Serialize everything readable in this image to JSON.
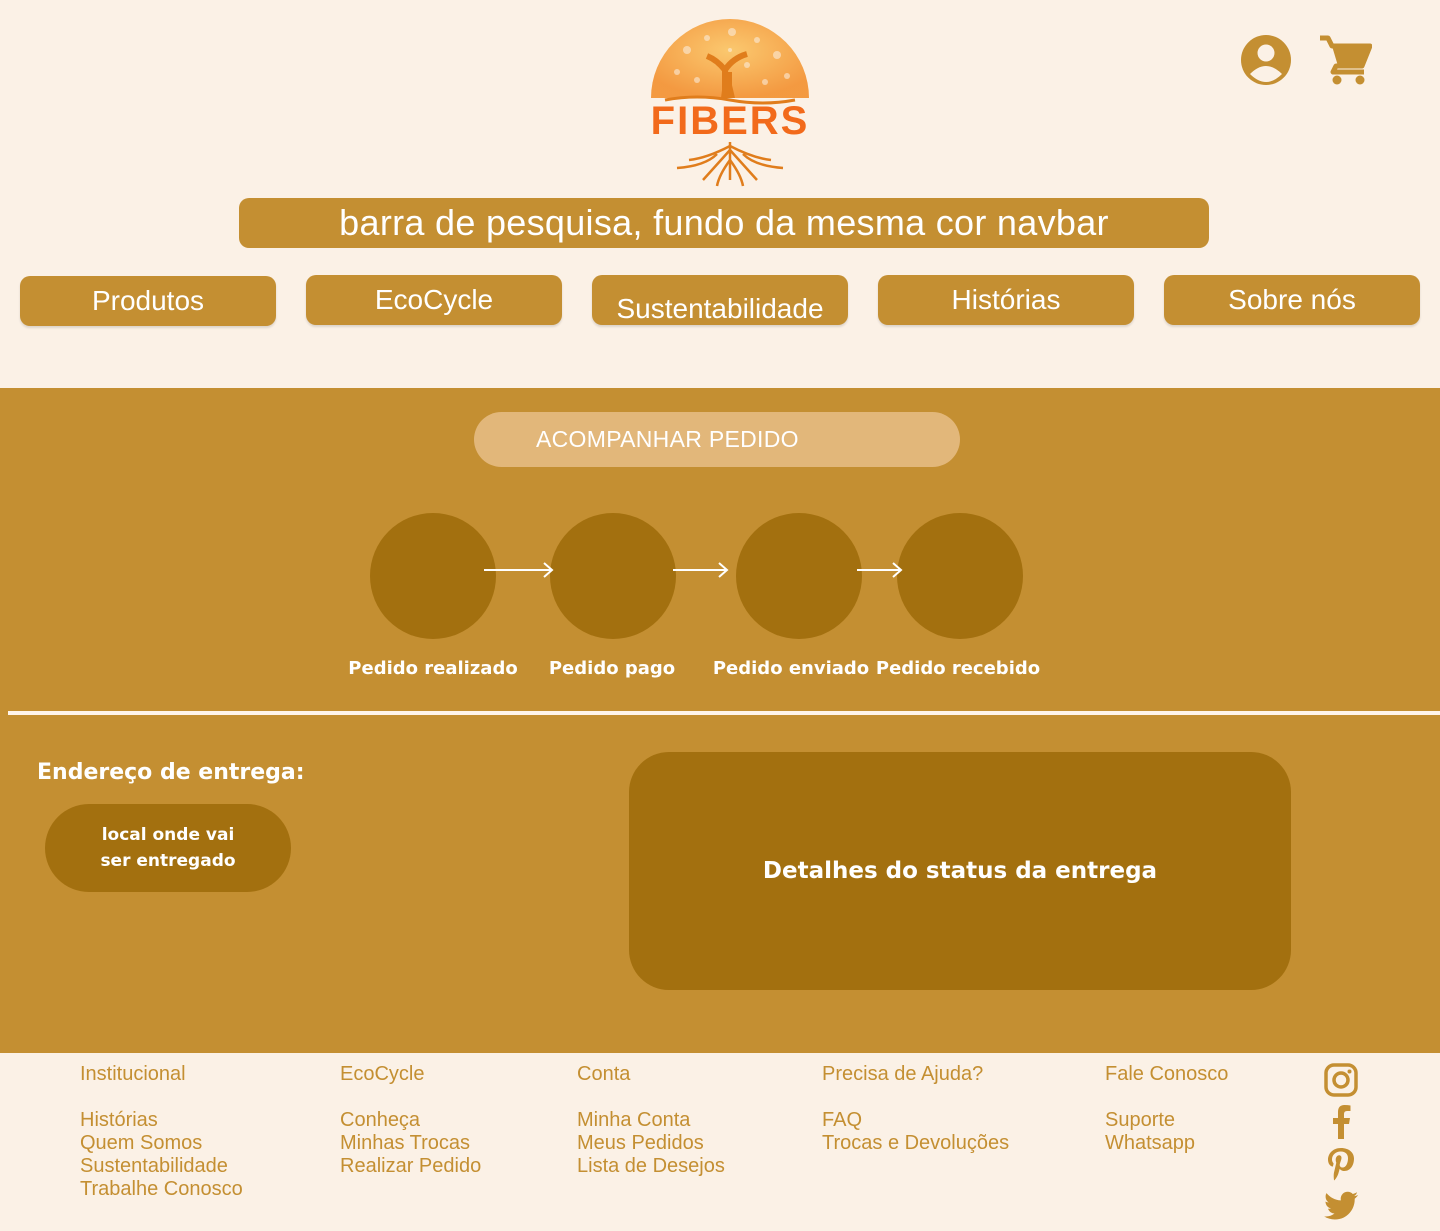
{
  "brand": {
    "name": "FIBERS"
  },
  "header": {
    "icons": [
      "user-account-icon",
      "shopping-cart-icon"
    ]
  },
  "search": {
    "placeholder_text": "barra de pesquisa, fundo da mesma cor navbar"
  },
  "nav": {
    "items": [
      "Produtos",
      "EcoCycle",
      "Sustentabilidade",
      "Histórias",
      "Sobre nós"
    ]
  },
  "tracking": {
    "title": "ACOMPANHAR PEDIDO",
    "steps": [
      "Pedido realizado",
      "Pedido pago",
      "Pedido enviado",
      "Pedido recebido"
    ]
  },
  "address": {
    "title": "Endereço de entrega:",
    "value": "local onde vai ser entregado"
  },
  "status": {
    "details_label": "Detalhes do status da entrega"
  },
  "footer": {
    "columns": [
      {
        "heading": "Institucional",
        "links": [
          "Histórias",
          "Quem Somos",
          "Sustentabilidade",
          "Trabalhe Conosco"
        ]
      },
      {
        "heading": "EcoCycle",
        "links": [
          "Conheça",
          "Minhas Trocas",
          "Realizar Pedido"
        ]
      },
      {
        "heading": "Conta",
        "links": [
          "Minha Conta",
          "Meus Pedidos",
          "Lista de Desejos"
        ]
      },
      {
        "heading": "Precisa de Ajuda?",
        "links": [
          "FAQ",
          "Trocas e Devoluções"
        ]
      },
      {
        "heading": "Fale Conosco",
        "links": [
          "Suporte",
          "Whatsapp"
        ]
      }
    ],
    "social": [
      "instagram-icon",
      "facebook-icon",
      "pinterest-icon",
      "twitter-icon"
    ]
  },
  "colors": {
    "background": "#fbf1e6",
    "primary": "#c48f32",
    "dark": "#a3700f",
    "light_pill": "#e2b77a",
    "logo_orange": "#f26a1b"
  }
}
